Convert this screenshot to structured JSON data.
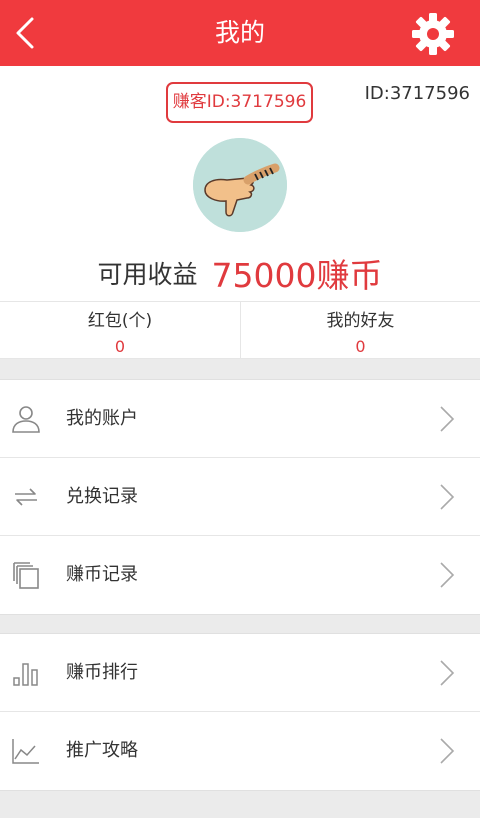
{
  "header": {
    "title": "我的",
    "back_icon": "chevron-left-icon",
    "settings_icon": "gear-icon",
    "color": "#f03a3e"
  },
  "profile": {
    "badge_text": "赚客ID:3717596",
    "id_text": "ID:3717596",
    "avatar_icon": "thumbs-down-avatar",
    "earnings_label": "可用收益",
    "earnings_value": "75000赚币"
  },
  "stats": [
    {
      "label": "红包(个)",
      "value": "0"
    },
    {
      "label": "我的好友",
      "value": "0"
    }
  ],
  "menu": {
    "group1": [
      {
        "label": "我的账户",
        "icon": "user-icon"
      },
      {
        "label": "兑换记录",
        "icon": "exchange-arrows-icon"
      },
      {
        "label": "赚币记录",
        "icon": "copy-pages-icon"
      }
    ],
    "group2": [
      {
        "label": "赚币排行",
        "icon": "bar-chart-icon"
      },
      {
        "label": "推广攻略",
        "icon": "line-chart-icon"
      }
    ]
  },
  "colors": {
    "accent": "#e03a3e",
    "background": "#ebebeb"
  }
}
